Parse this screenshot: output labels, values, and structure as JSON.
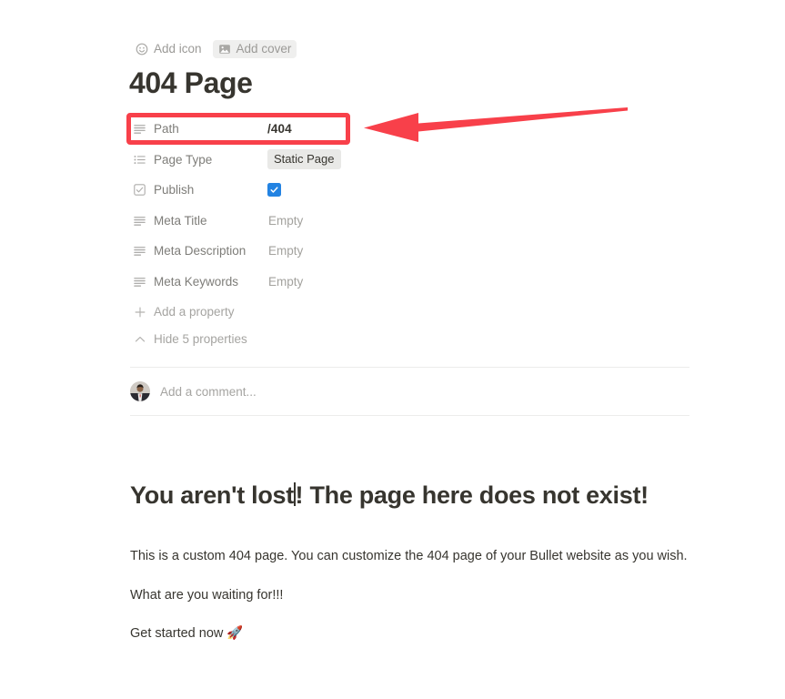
{
  "header": {
    "add_icon_label": "Add icon",
    "add_icon_glyph": "smiley-icon",
    "add_cover_label": "Add cover",
    "add_cover_glyph": "image-icon",
    "title": "404 Page"
  },
  "properties": {
    "rows": [
      {
        "icon": "text-lines-icon",
        "label": "Path",
        "value": "/404",
        "value_type": "text-bold"
      },
      {
        "icon": "select-list-icon",
        "label": "Page Type",
        "value": "Static Page",
        "value_type": "tag"
      },
      {
        "icon": "checkbox-icon",
        "label": "Publish",
        "value": "",
        "value_type": "checkbox",
        "checked": true
      },
      {
        "icon": "text-lines-icon",
        "label": "Meta Title",
        "value": "Empty",
        "value_type": "empty"
      },
      {
        "icon": "text-lines-icon",
        "label": "Meta Description",
        "value": "Empty",
        "value_type": "empty"
      },
      {
        "icon": "text-lines-icon",
        "label": "Meta Keywords",
        "value": "Empty",
        "value_type": "empty"
      }
    ],
    "add_property_label": "Add a property",
    "add_property_icon": "plus-icon",
    "hide_properties_label": "Hide 5 properties",
    "hide_properties_icon": "chevron-up-icon"
  },
  "comment": {
    "placeholder": "Add a comment...",
    "avatar": "user-avatar"
  },
  "content": {
    "heading_before_caret": "You aren't lost",
    "heading_after_caret": "! The page here does not exist!",
    "paragraph_1": "This is a custom 404 page. You can customize the 404 page of your Bullet website as you wish.",
    "paragraph_2": "What are you waiting for!!!",
    "paragraph_3": "Get started now 🚀"
  },
  "annotations": {
    "highlight_color": "#f8404a",
    "highlight_target": "Path",
    "arrow_direction": "left"
  },
  "colors": {
    "text": "#37352f",
    "muted": "#9b9a97",
    "accent_checkbox": "#2383e2",
    "tag_bg": "#e9e9e7",
    "annotation_red": "#f8404a"
  }
}
